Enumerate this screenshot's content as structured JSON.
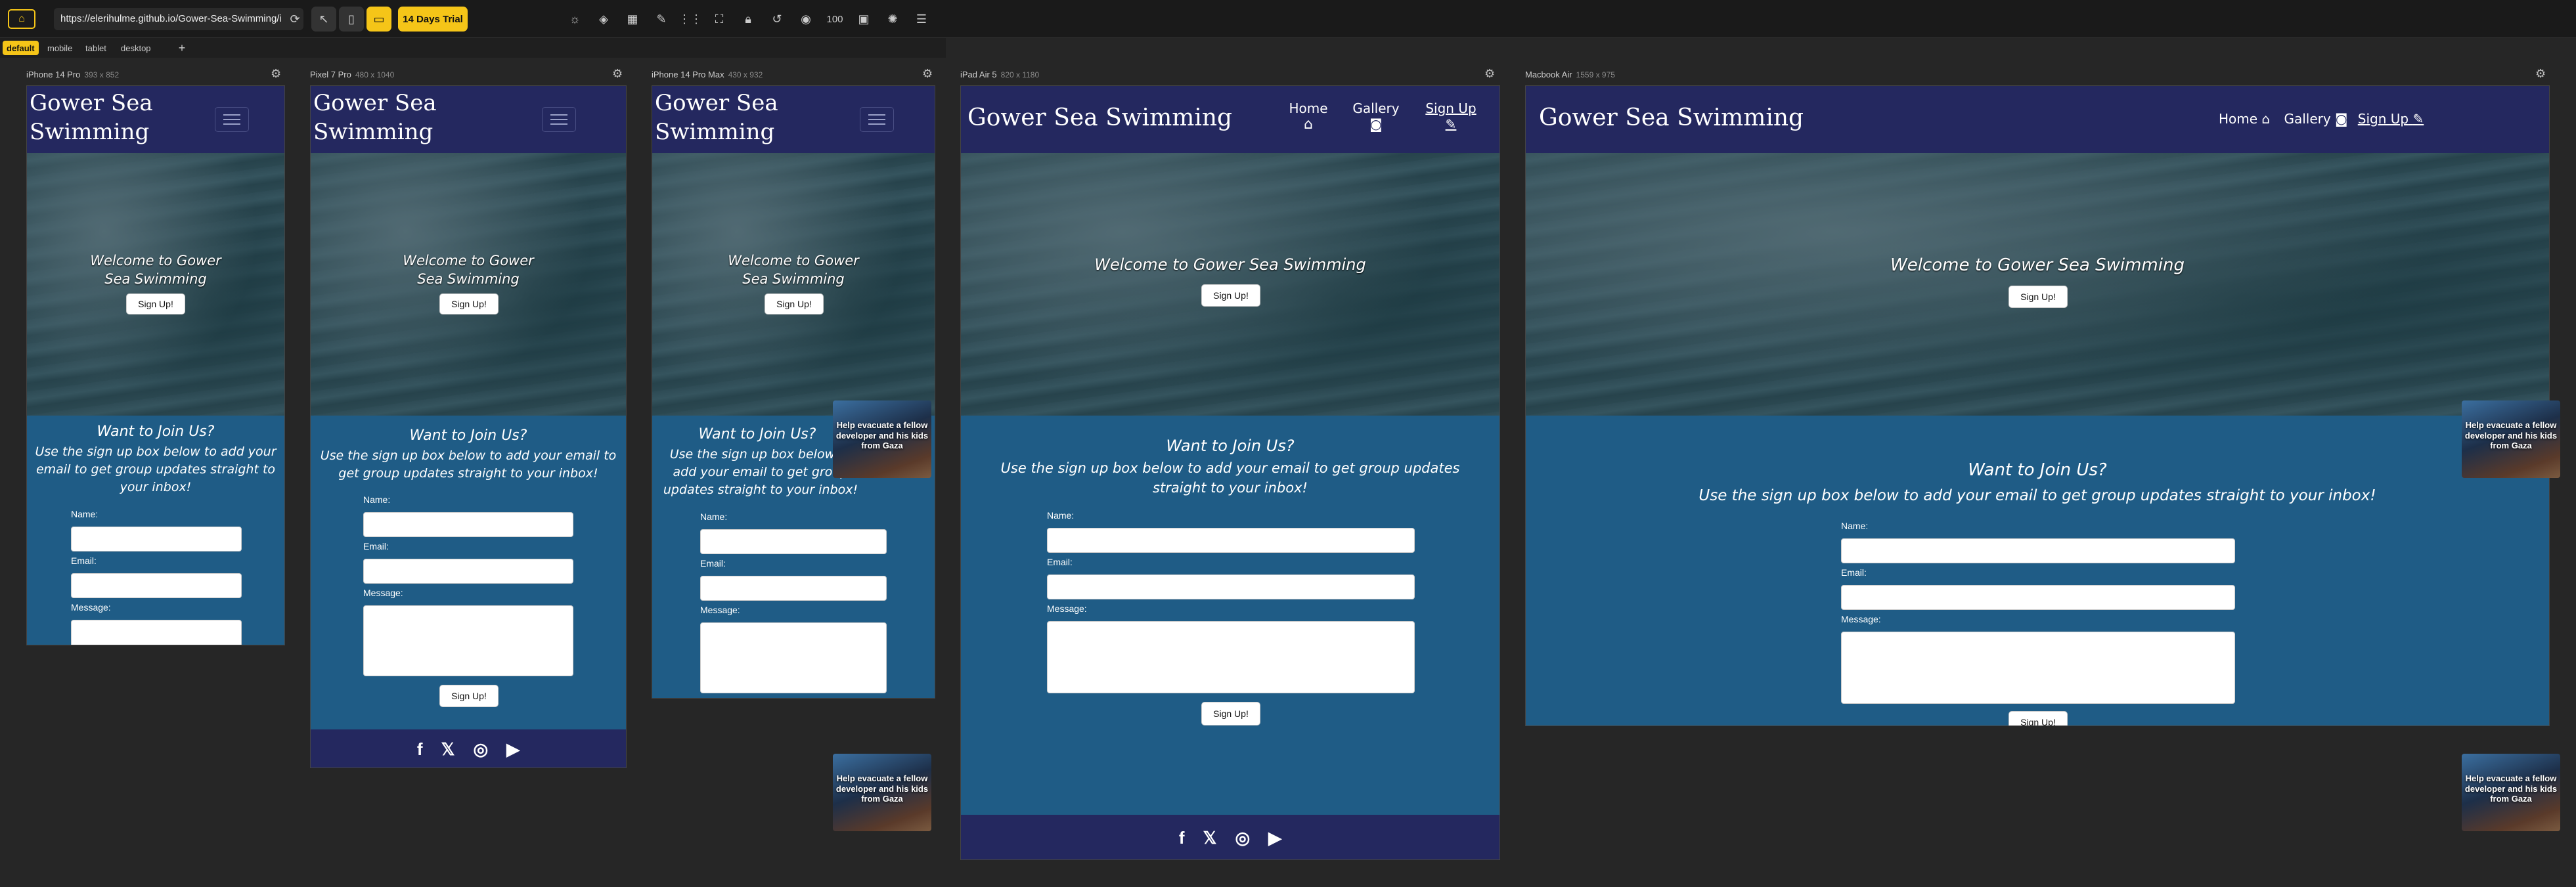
{
  "toolbar": {
    "url": "https://elerihulme.github.io/Gower-Sea-Swimming/i",
    "trial_label": "14 Days Trial",
    "zoom": "100",
    "icons": [
      "refresh-icon",
      "pointer-icon",
      "phone-icon",
      "screens-icon",
      "sun-icon",
      "layers-icon",
      "grid-icon",
      "ruler-icon",
      "dots-icon",
      "lock-icon",
      "undo-icon",
      "camera-icon",
      "code-icon",
      "settings-icon",
      "menu-icon"
    ]
  },
  "tabs": [
    "default",
    "mobile",
    "tablet",
    "desktop"
  ],
  "active_tab": "default",
  "site": {
    "title": "Gower Sea Swimming",
    "hero_heading": "Welcome to Gower Sea Swimming",
    "hero_button": "Sign Up!",
    "join_heading": "Want to Join Us?",
    "join_text": "Use the sign up box below to add your email to get group updates straight to your inbox!",
    "name_label": "Name:",
    "email_label": "Email:",
    "message_label": "Message:",
    "submit_label": "Sign Up!",
    "nav": {
      "home": "Home",
      "gallery": "Gallery",
      "signup": "Sign Up"
    },
    "footer_icons": [
      "facebook-icon",
      "x-icon",
      "instagram-icon",
      "youtube-icon"
    ]
  },
  "devices": [
    {
      "name": "iPhone 14 Pro",
      "size": "393 x 852"
    },
    {
      "name": "Pixel 7 Pro",
      "size": "480 x 1040"
    },
    {
      "name": "iPhone 14 Pro Max",
      "size": "430 x 932"
    },
    {
      "name": "iPad Air 5",
      "size": "820 x 1180"
    },
    {
      "name": "Macbook Air",
      "size": "1559 x 975"
    }
  ],
  "ad": {
    "text": "Help evacuate a fellow developer and his kids from Gaza"
  },
  "colors": {
    "accent": "#f5c518",
    "header": "#24285f",
    "section": "#1f5c86"
  }
}
